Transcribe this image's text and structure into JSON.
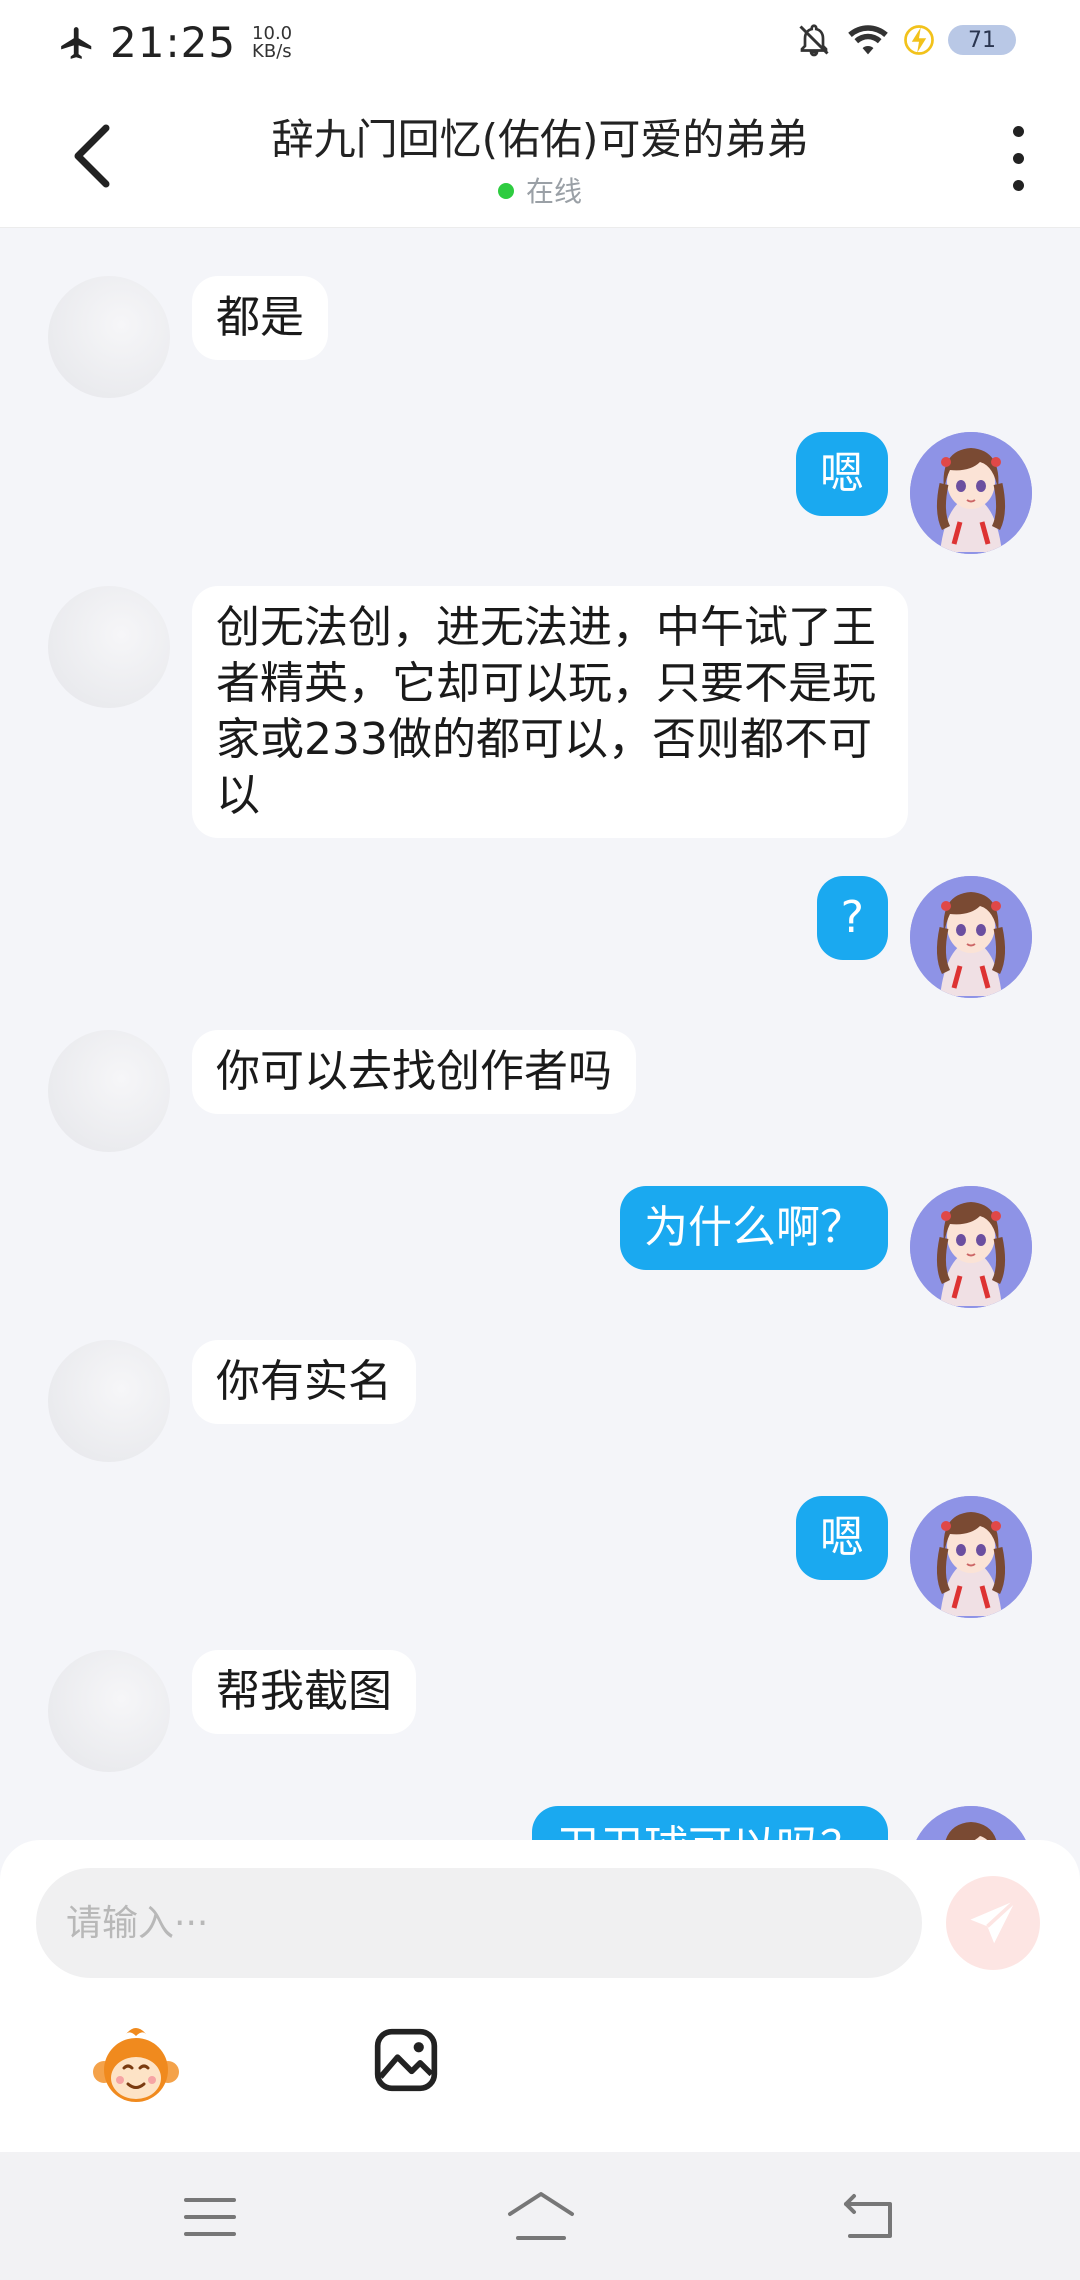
{
  "status_bar": {
    "time": "21:25",
    "speed_value": "10.0",
    "speed_unit": "KB/s",
    "battery": "71",
    "icons": [
      "airplane-mode-icon",
      "mute-icon",
      "wifi-icon",
      "charging-icon",
      "battery-icon"
    ]
  },
  "header": {
    "title": "辞九门回忆(佑佑)可爱的弟弟",
    "status": "在线",
    "status_color": "#2ecc40"
  },
  "messages": [
    {
      "side": "left",
      "text": "都是"
    },
    {
      "side": "right",
      "text": "嗯"
    },
    {
      "side": "left",
      "text": "创无法创，进无法进，中午试了王者精英，它却可以玩，只要不是玩家或233做的都可以，否则都不可以"
    },
    {
      "side": "right",
      "text": "?"
    },
    {
      "side": "left",
      "text": "你可以去找创作者吗"
    },
    {
      "side": "right",
      "text": "为什么啊？"
    },
    {
      "side": "left",
      "text": "你有实名"
    },
    {
      "side": "right",
      "text": "嗯"
    },
    {
      "side": "left",
      "text": "帮我截图"
    },
    {
      "side": "right",
      "text": "卫卫球可以吗？"
    }
  ],
  "input": {
    "placeholder": "请输入···",
    "value": ""
  },
  "colors": {
    "accent": "#1aa9f0",
    "send_button": "#fde5e3"
  }
}
